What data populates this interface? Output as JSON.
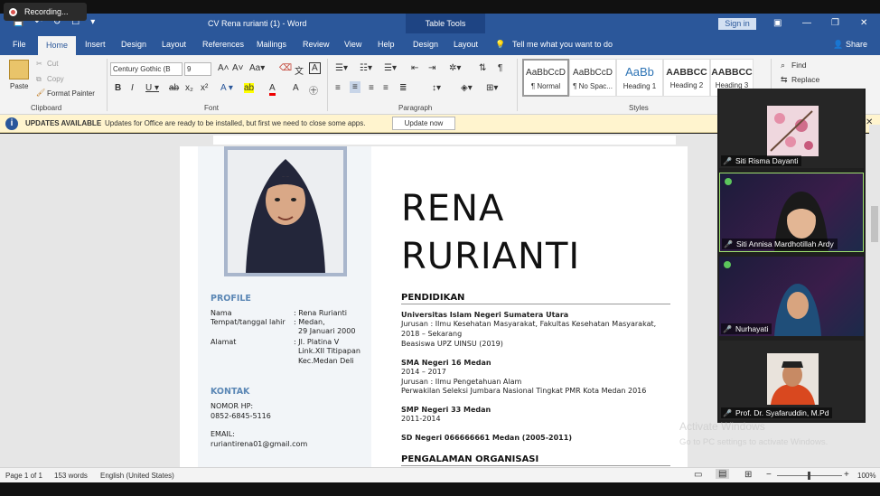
{
  "recording": {
    "label": "Recording..."
  },
  "window": {
    "title": "CV Rena rurianti (1)  -  Word",
    "table_tools": "Table Tools",
    "sign_in": "Sign in"
  },
  "menu": {
    "items": [
      "File",
      "Home",
      "Insert",
      "Design",
      "Layout",
      "References",
      "Mailings",
      "Review",
      "View",
      "Help",
      "Design",
      "Layout"
    ],
    "tell_me": "Tell me what you want to do",
    "share": "Share"
  },
  "ribbon": {
    "clipboard": {
      "paste": "Paste",
      "cut": "Cut",
      "copy": "Copy",
      "format_painter": "Format Painter",
      "label": "Clipboard"
    },
    "font": {
      "family": "Century Gothic (B",
      "size": "9",
      "label": "Font"
    },
    "paragraph": {
      "label": "Paragraph"
    },
    "styles": {
      "label": "Styles",
      "items": [
        {
          "preview": "AaBbCcD",
          "name": "¶ Normal"
        },
        {
          "preview": "AaBbCcD",
          "name": "¶ No Spac..."
        },
        {
          "preview": "AaBb",
          "name": "Heading 1"
        },
        {
          "preview": "AABBCC",
          "name": "Heading 2"
        },
        {
          "preview": "AABBCC",
          "name": "Heading 3"
        }
      ]
    },
    "editing": {
      "find": "Find",
      "replace": "Replace"
    }
  },
  "updates": {
    "title": "UPDATES AVAILABLE",
    "message": "Updates for Office are ready to be installed, but first we need to close some apps.",
    "button": "Update now"
  },
  "document": {
    "first_name": "RENA",
    "last_name": "RURIANTI",
    "profile": {
      "heading": "PROFILE",
      "nama_label": "Nama",
      "nama_value": ": Rena Rurianti",
      "ttl_label": "Tempat/tanggal lahir",
      "ttl_value1": ":  Medan,",
      "ttl_value2": "29 Januari 2000",
      "alamat_label": "Alamat",
      "alamat_value1": ": Jl. Platina V",
      "alamat_value2": "Link.XII Titipapan",
      "alamat_value3": "Kec.Medan Deli"
    },
    "kontak": {
      "heading": "KONTAK",
      "hp_label": "NOMOR HP:",
      "hp_value": "0852-6845-5116",
      "email_label": "EMAIL:",
      "email_value": "ruriantirena01@gmail.com"
    },
    "pendidikan": {
      "heading": "PENDIDIKAN",
      "uin_title": "Universitas Islam Negeri Sumatera Utara",
      "uin_l1": "Jurusan : Ilmu Kesehatan Masyarakat, Fakultas Kesehatan Masyarakat,",
      "uin_l2": "2018 – Sekarang",
      "uin_l3": "Beasiswa UPZ UINSU (2019)",
      "sma_title": "SMA Negeri 16 Medan",
      "sma_l1": "2014 – 2017",
      "sma_l2": "Jurusan : Ilmu Pengetahuan Alam",
      "sma_l3": "Perwakilan Seleksi Jumbara Nasional Tingkat PMR Kota Medan 2016",
      "smp_title": "SMP Negeri 33 Medan",
      "smp_l1": "2011-2014",
      "sd_title": "SD Negeri 066666661 Medan (2005-2011)"
    },
    "organisasi": {
      "heading": "PENGALAMAN ORGANISASI"
    }
  },
  "participants": [
    {
      "name": "Siti Risma Dayanti"
    },
    {
      "name": "Siti Annisa Mardhotillah Ardy"
    },
    {
      "name": "Nurhayati"
    },
    {
      "name": "Prof. Dr. Syafaruddin, M.Pd"
    }
  ],
  "watermark": {
    "line1": "Activate Windows",
    "line2": "Go to PC settings to activate Windows."
  },
  "status": {
    "page": "Page 1 of 1",
    "words": "153 words",
    "language": "English (United States)",
    "zoom": "100%"
  },
  "colors": {
    "word_blue": "#2b579a",
    "accent_heading": "#5b87b5",
    "update_bar": "#fff4ce"
  }
}
